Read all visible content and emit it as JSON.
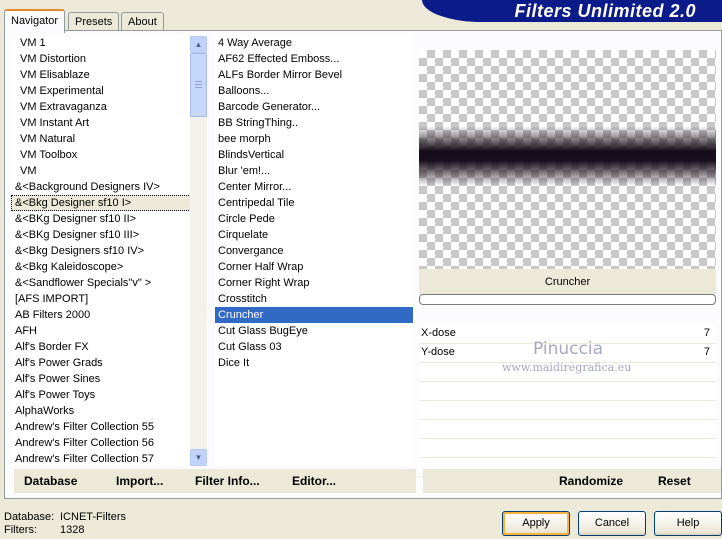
{
  "app": {
    "title": "Filters Unlimited 2.0"
  },
  "tabs": [
    {
      "label": "Navigator",
      "active": true
    },
    {
      "label": "Presets",
      "active": false
    },
    {
      "label": "About",
      "active": false
    }
  ],
  "categories": [
    "VM 1",
    "VM Distortion",
    "VM Elisablaze",
    "VM Experimental",
    "VM Extravaganza",
    "VM Instant Art",
    "VM Natural",
    "VM Toolbox",
    "VM",
    "&<Background Designers IV>",
    "&<Bkg Designer sf10 I>",
    "&<BKg Designer sf10 II>",
    "&<BKg Designer sf10 III>",
    "&<Bkg Designers sf10 IV>",
    "&<Bkg Kaleidoscope>",
    "&<Sandflower Specials\"v\" >",
    "[AFS IMPORT]",
    "AB Filters 2000",
    "AFH",
    "Alf's Border FX",
    "Alf's Power Grads",
    "Alf's Power Sines",
    "Alf's Power Toys",
    "AlphaWorks",
    "Andrew's Filter Collection 55",
    "Andrew's Filter Collection 56",
    "Andrew's Filter Collection 57"
  ],
  "selected_category_index": 10,
  "filters": [
    "4 Way Average",
    "AF62 Effected Emboss...",
    "ALFs Border Mirror Bevel",
    "Balloons...",
    "Barcode Generator...",
    "BB StringThing..",
    "bee morph",
    "BlindsVertical",
    "Blur 'em!...",
    "Center Mirror...",
    "Centripedal Tile",
    "Circle Pede",
    "Cirquelate",
    "Convergance",
    "Corner Half Wrap",
    "Corner Right Wrap",
    "Crosstitch",
    "Cruncher",
    "Cut Glass  BugEye",
    "Cut Glass 03",
    "Dice It"
  ],
  "selected_filter_index": 17,
  "preview": {
    "filter_name": "Cruncher"
  },
  "params": [
    {
      "label": "X-dose",
      "value": "7"
    },
    {
      "label": "Y-dose",
      "value": "7"
    }
  ],
  "watermark": {
    "name": "Pinuccia",
    "url": "www.maidiregrafica.eu"
  },
  "left_bar": {
    "database": "Database",
    "import": "Import...",
    "filter_info": "Filter Info...",
    "editor": "Editor..."
  },
  "right_bar": {
    "randomize": "Randomize",
    "reset": "Reset"
  },
  "status": {
    "db_label": "Database:",
    "db_value": "ICNET-Filters",
    "filters_label": "Filters:",
    "filters_value": "1328"
  },
  "buttons": {
    "apply": "Apply",
    "cancel": "Cancel",
    "help": "Help"
  },
  "colors": {
    "brand": "#0c1b8a",
    "selection": "#316ac5",
    "tab_accent": "#e68b2c",
    "default_button_ring": "#f8b33a"
  }
}
